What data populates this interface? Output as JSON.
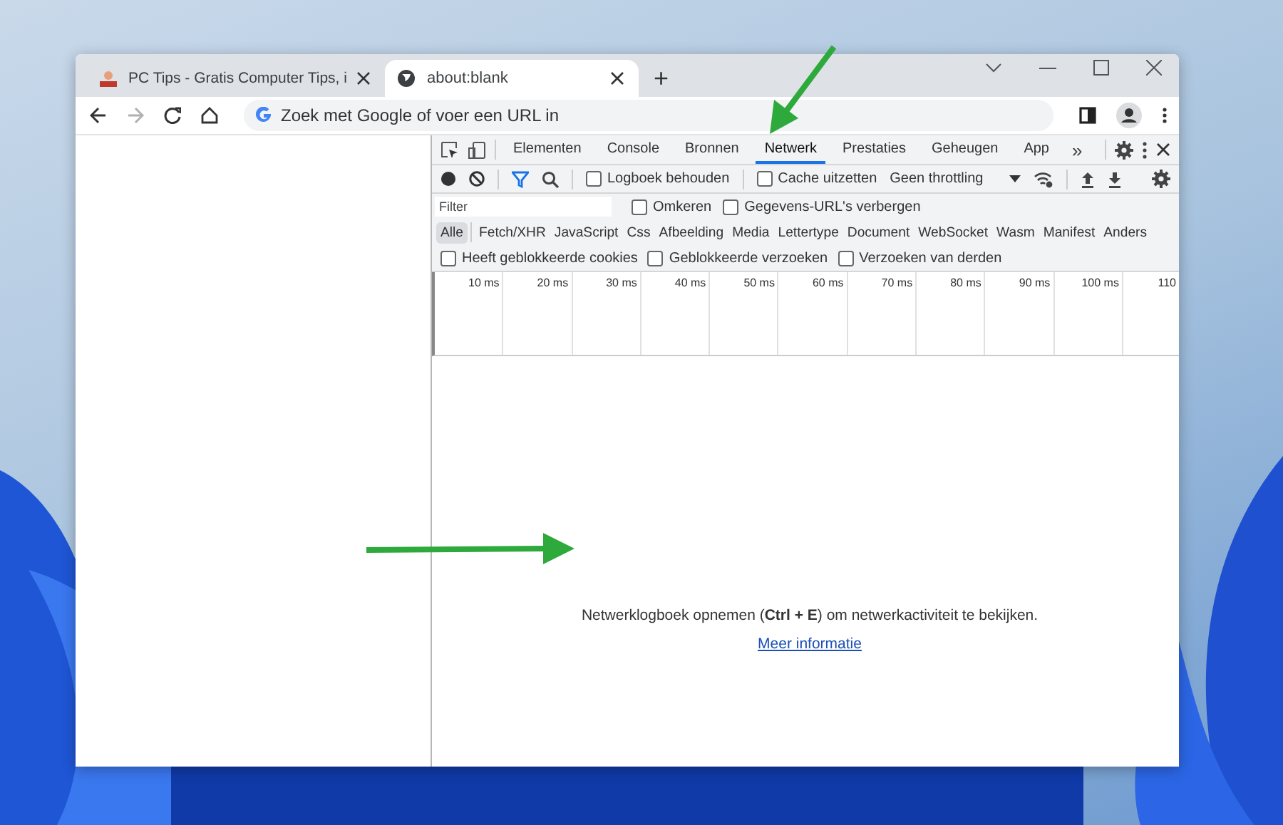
{
  "browser_tabs": [
    {
      "title": "PC Tips - Gratis Computer Tips, i",
      "selected": false
    },
    {
      "title": "about:blank",
      "selected": true
    }
  ],
  "new_tab": "+",
  "forward_button": {
    "disabled": true
  },
  "address_bar": {
    "placeholder": "Zoek met Google of voer een URL in"
  },
  "devtools": {
    "panels": [
      {
        "label": "Elementen",
        "selected": false
      },
      {
        "label": "Console",
        "selected": false
      },
      {
        "label": "Bronnen",
        "selected": false
      },
      {
        "label": "Netwerk",
        "selected": true
      },
      {
        "label": "Prestaties",
        "selected": false
      },
      {
        "label": "Geheugen",
        "selected": false
      },
      {
        "label": "App",
        "selected": false
      }
    ],
    "more_panels": "»",
    "network_toolbar": {
      "filter_active": true,
      "checkboxes": [
        {
          "label": "Logboek behouden",
          "checked": false
        },
        {
          "label": "Cache uitzetten",
          "checked": false
        }
      ],
      "throttling": "Geen throttling"
    },
    "filter_bar": {
      "placeholder": "Filter",
      "checkboxes": [
        {
          "label": "Omkeren",
          "checked": false
        },
        {
          "label": "Gegevens-URL's verbergen",
          "checked": false
        }
      ]
    },
    "type_filters": [
      {
        "label": "Alle",
        "selected": true
      },
      {
        "label": "Fetch/XHR",
        "selected": false
      },
      {
        "label": "JavaScript",
        "selected": false
      },
      {
        "label": "Css",
        "selected": false
      },
      {
        "label": "Afbeelding",
        "selected": false
      },
      {
        "label": "Media",
        "selected": false
      },
      {
        "label": "Lettertype",
        "selected": false
      },
      {
        "label": "Document",
        "selected": false
      },
      {
        "label": "WebSocket",
        "selected": false
      },
      {
        "label": "Wasm",
        "selected": false
      },
      {
        "label": "Manifest",
        "selected": false
      },
      {
        "label": "Anders",
        "selected": false
      }
    ],
    "extra_filters": [
      {
        "label": "Heeft geblokkeerde cookies",
        "checked": false
      },
      {
        "label": "Geblokkeerde verzoeken",
        "checked": false
      },
      {
        "label": "Verzoeken van derden",
        "checked": false
      }
    ],
    "timeline_ticks": [
      "10 ms",
      "20 ms",
      "30 ms",
      "40 ms",
      "50 ms",
      "60 ms",
      "70 ms",
      "80 ms",
      "90 ms",
      "100 ms",
      "110"
    ],
    "empty_message": {
      "text": "Netwerklogboek opnemen (**Ctrl + E**) om netwerkactiviteit te bekijken.",
      "link": "Meer informatie"
    }
  }
}
